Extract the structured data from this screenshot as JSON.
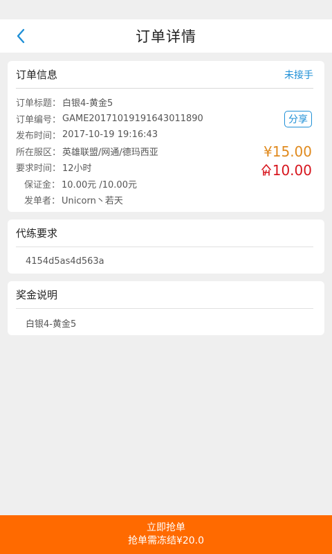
{
  "header": {
    "title": "订单详情"
  },
  "order_info": {
    "section_title": "订单信息",
    "status": "未接手",
    "rows": [
      {
        "label": "订单标题：",
        "value": "白银4-黄金5"
      },
      {
        "label": "订单编号：",
        "value": "GAME20171019191643011890"
      },
      {
        "label": "发布时间：",
        "value": "2017-10-19 19:16:43"
      },
      {
        "label": "所在服区：",
        "value": "英雄联盟/网通/德玛西亚"
      },
      {
        "label": "要求时间：",
        "value": "12小时"
      },
      {
        "label": "保证金：",
        "value": "10.00元 /10.00元"
      },
      {
        "label": "发单者：",
        "value": "Unicorn丶若天"
      }
    ],
    "share_label": "分享",
    "deposit_amount": "¥15.00",
    "reward_amount": "10.00"
  },
  "requirements": {
    "section_title": "代练要求",
    "text": "4154d5as4d563a"
  },
  "reward_desc": {
    "section_title": "奖金说明",
    "text": "白银4-黄金5"
  },
  "bottom_bar": {
    "primary": "立即抢单",
    "secondary": "抢单需冻结¥20.0"
  },
  "colors": {
    "accent_blue": "#1e8fd6",
    "orange": "#ff6a00",
    "deposit": "#e08a1e",
    "reward": "#d7161e"
  },
  "icons": {
    "back": "chevron-left-icon",
    "reward": "reward-coin-icon"
  }
}
